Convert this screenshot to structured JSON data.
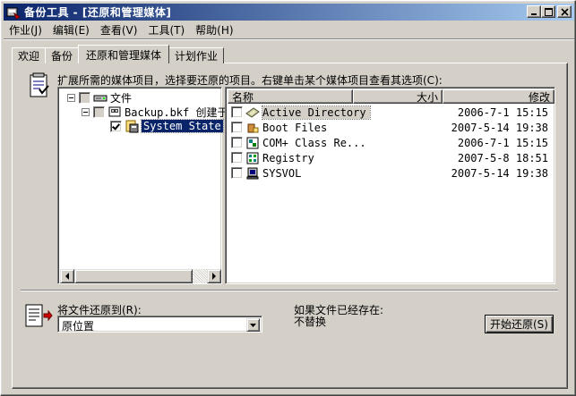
{
  "window": {
    "title": "备份工具 - [还原和管理媒体]"
  },
  "menu": [
    "作业(J)",
    "编辑(E)",
    "查看(V)",
    "工具(T)",
    "帮助(H)"
  ],
  "tabs": [
    "欢迎",
    "备份",
    "还原和管理媒体",
    "计划作业"
  ],
  "active_tab": "还原和管理媒体",
  "instruction": "扩展所需的媒体项目，选择要还原的项目。右键单击某个媒体项目查看其选项(C):",
  "tree": {
    "root": {
      "label": "文件",
      "icon": "drive-icon"
    },
    "backup": {
      "label": "Backup.bkf 创建于",
      "icon": "tape-icon"
    },
    "system_state": {
      "label": "System State",
      "icon": "system-state-icon",
      "checked": true
    }
  },
  "list": {
    "columns": [
      "名称",
      "大小",
      "修改"
    ],
    "rows": [
      {
        "name": "Active Directory",
        "date": "2006-7-1 15:15",
        "icon": "active-directory-icon"
      },
      {
        "name": "Boot Files",
        "date": "2007-5-14 19:38",
        "icon": "boot-files-icon"
      },
      {
        "name": "COM+ Class Re...",
        "date": "2006-7-1 15:15",
        "icon": "com-class-icon"
      },
      {
        "name": "Registry",
        "date": "2007-5-8 18:51",
        "icon": "registry-icon"
      },
      {
        "name": "SYSVOL",
        "date": "2007-5-14 19:38",
        "icon": "sysvol-icon"
      }
    ]
  },
  "restore": {
    "label": "将文件还原到(R):",
    "value": "原位置"
  },
  "exists": {
    "label": "如果文件已经存在:",
    "value": "不替换"
  },
  "start_button": "开始还原(S)"
}
